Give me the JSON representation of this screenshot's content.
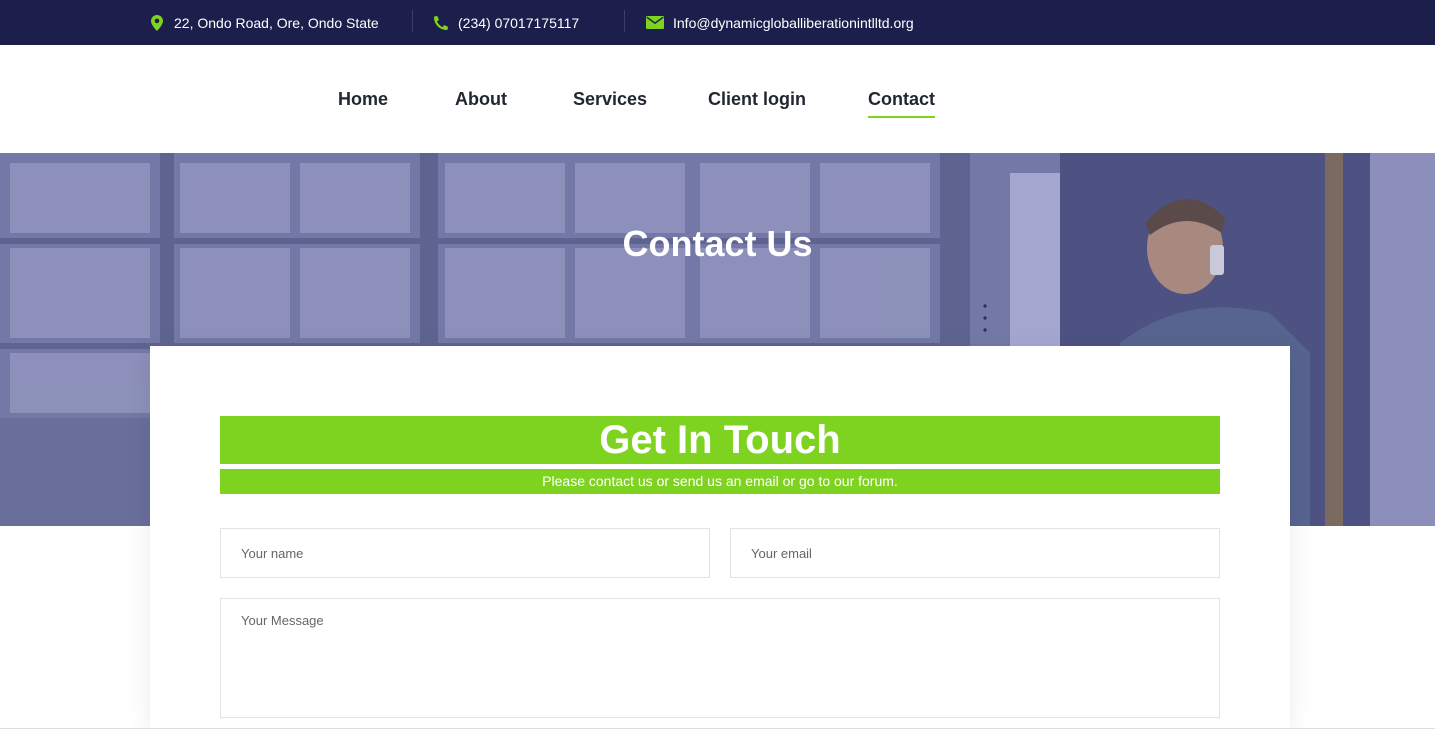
{
  "topbar": {
    "address": "22, Ondo Road, Ore, Ondo State",
    "phone": "(234) 07017175117",
    "email": "Info@dynamicgloballiberationintlltd.org",
    "icons": [
      "map-pin-icon",
      "phone-icon",
      "envelope-icon"
    ],
    "background": "#1c1f4c",
    "icon_color": "#7ed321"
  },
  "nav": {
    "items": [
      {
        "label": "Home"
      },
      {
        "label": "About"
      },
      {
        "label": "Services"
      },
      {
        "label": "Client login"
      },
      {
        "label": "Contact"
      }
    ],
    "active": "Contact",
    "active_color": "#7ed321"
  },
  "hero": {
    "title": "Contact Us"
  },
  "contact_form": {
    "heading": "Get In Touch",
    "subheading": "Please contact us or send us an email or go to our forum.",
    "accent": "#7ed321",
    "name_placeholder": "Your name",
    "email_placeholder": "Your email",
    "message_placeholder": "Your Message"
  }
}
